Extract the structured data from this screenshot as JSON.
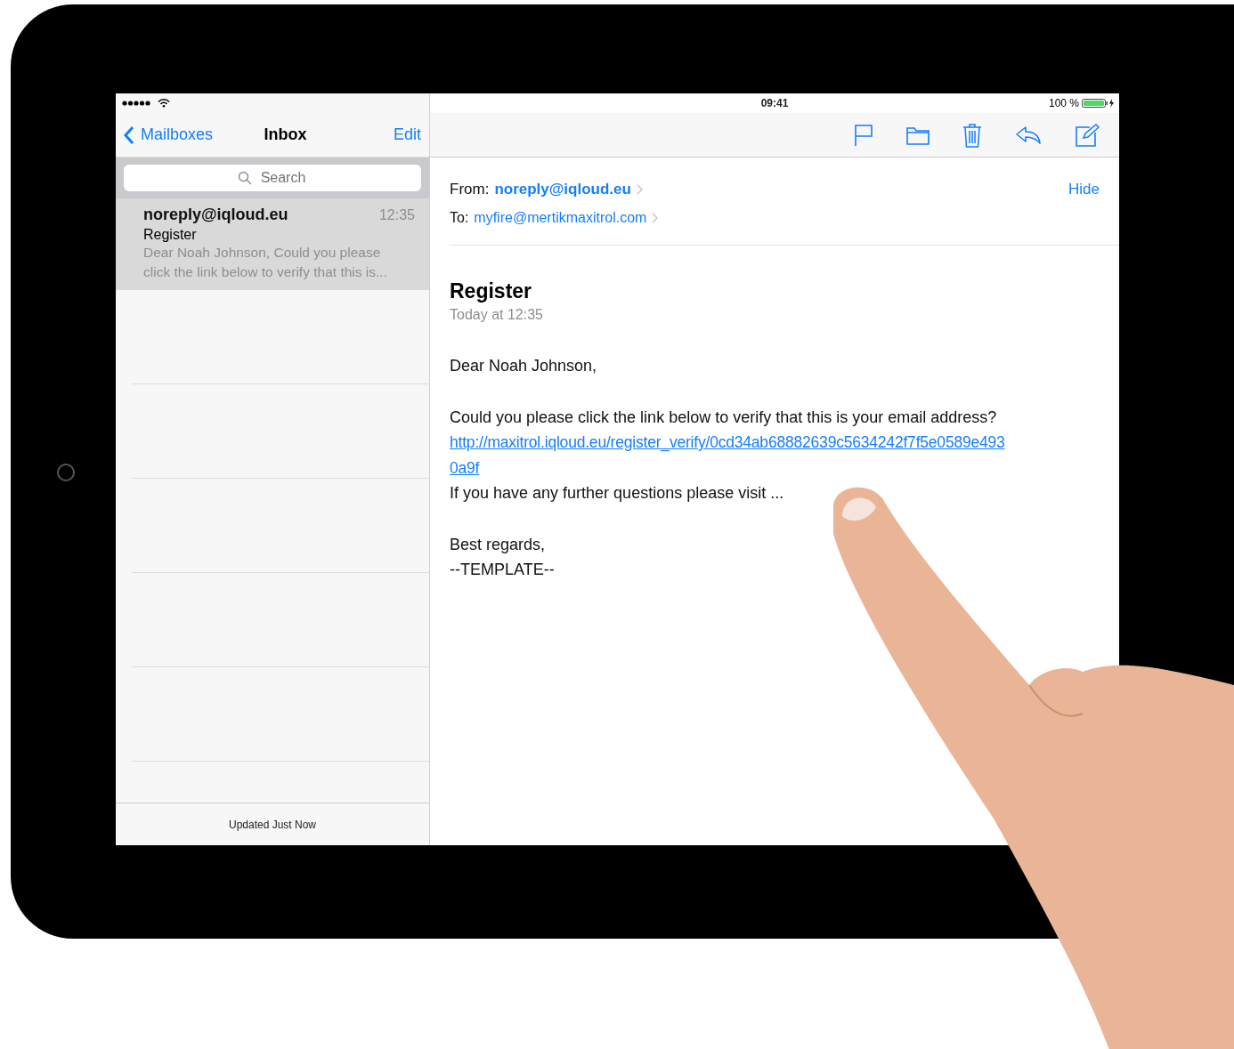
{
  "status_bar": {
    "time": "09:41",
    "battery": "100 %"
  },
  "sidebar": {
    "back": "Mailboxes",
    "title": "Inbox",
    "edit": "Edit",
    "search": {
      "placeholder": "Search"
    },
    "messages": [
      {
        "sender": "noreply@iqloud.eu",
        "time": "12:35",
        "subject": "Register",
        "preview": "Dear Noah Johnson, Could you please click the link below to verify that this is...",
        "selected": true
      }
    ],
    "footer": "Updated Just Now"
  },
  "message": {
    "from_label": "From:",
    "from": "noreply@iqloud.eu",
    "to_label": "To:",
    "to": "myfire@mertikmaxitrol.com",
    "hide": "Hide",
    "subject": "Register",
    "date": "Today at 12:35",
    "body": [
      {
        "kind": "text",
        "text": "Dear Noah Johnson,"
      },
      {
        "kind": "gap"
      },
      {
        "kind": "text",
        "text": "Could you please click the link below to verify that this is your email address?"
      },
      {
        "kind": "link",
        "text": "http://maxitrol.iqloud.eu/register_verify/0cd34ab68882639c5634242f7f5e0589e493"
      },
      {
        "kind": "link",
        "text": "0a9f"
      },
      {
        "kind": "text",
        "text": "If you have any further questions please visit ..."
      },
      {
        "kind": "gap"
      },
      {
        "kind": "text",
        "text": "Best regards,"
      },
      {
        "kind": "text",
        "text": "--TEMPLATE--"
      }
    ]
  }
}
